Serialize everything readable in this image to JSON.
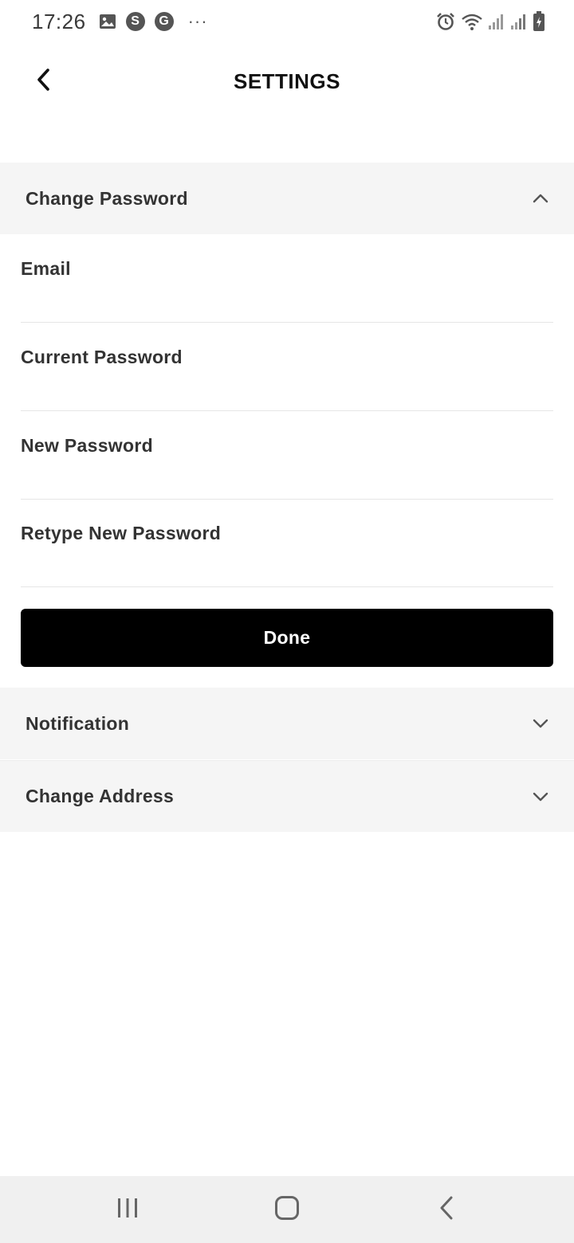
{
  "status_bar": {
    "time": "17:26",
    "left_icons": [
      "gallery-icon",
      "skype-icon",
      "google-icon",
      "more-dots-icon"
    ],
    "skype_letter": "S",
    "google_letter": "G",
    "dots": "···",
    "right_icons": [
      "alarm-icon",
      "wifi-icon",
      "signal-icon",
      "signal-icon",
      "battery-charging-icon"
    ]
  },
  "header": {
    "title": "SETTINGS",
    "back_icon": "chevron-left-icon"
  },
  "sections": {
    "change_password": {
      "title": "Change Password",
      "expanded": true,
      "fields": [
        {
          "label": "Email",
          "value": ""
        },
        {
          "label": "Current Password",
          "value": ""
        },
        {
          "label": "New Password",
          "value": ""
        },
        {
          "label": "Retype New Password",
          "value": ""
        }
      ],
      "submit_label": "Done"
    },
    "notification": {
      "title": "Notification",
      "expanded": false
    },
    "change_address": {
      "title": "Change Address",
      "expanded": false
    }
  },
  "colors": {
    "section_bg": "#f5f5f5",
    "button_bg": "#000000",
    "button_text": "#ffffff",
    "text": "#333333"
  },
  "nav_bar": {
    "buttons": [
      "recent-apps-icon",
      "home-icon",
      "back-icon"
    ]
  }
}
